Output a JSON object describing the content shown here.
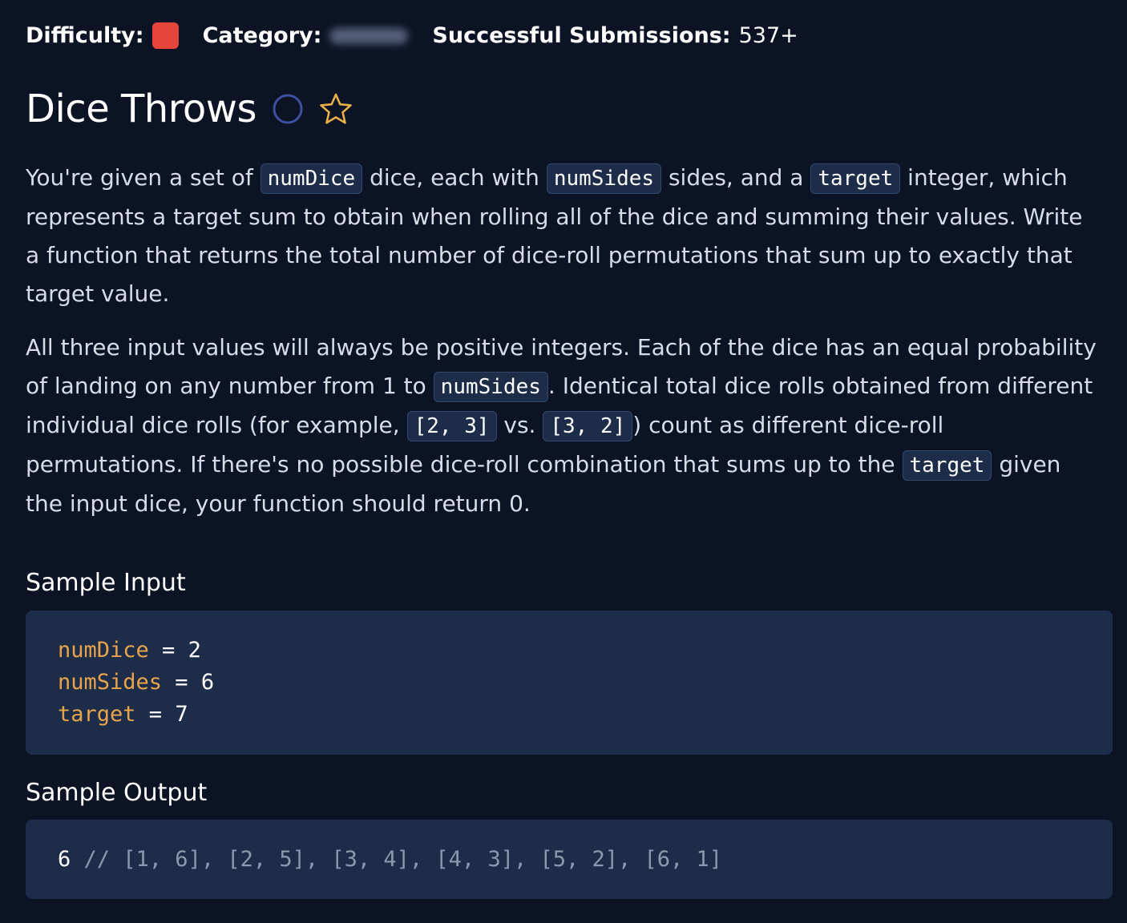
{
  "meta": {
    "difficulty_label": "Difficulty:",
    "difficulty_color": "#e5453a",
    "category_label": "Category:",
    "submissions_label": "Successful Submissions:",
    "submissions_value": "537+"
  },
  "title": "Dice Throws",
  "icons": {
    "status": "circle-icon",
    "favorite": "star-icon",
    "star_color": "#e8b04a",
    "circle_color": "#3d4f9e"
  },
  "description": {
    "p1": {
      "t1": "You're given a set of ",
      "c1": "numDice",
      "t2": " dice, each with ",
      "c2": "numSides",
      "t3": " sides, and a ",
      "c3": "target",
      "t4": " integer, which represents a target sum to obtain when rolling all of the dice and summing their values. Write a function that returns the total number of dice-roll permutations that sum up to exactly that target value."
    },
    "p2": {
      "t1": "All three input values will always be positive integers. Each of the dice has an equal probability of landing on any number from 1 to ",
      "c1": "numSides",
      "t2": ". Identical total dice rolls obtained from different individual dice rolls (for example, ",
      "c2": "[2, 3]",
      "t3": " vs. ",
      "c3": "[3, 2]",
      "t4": ") count as different dice-roll permutations. If there's no possible dice-roll combination that sums up to the ",
      "c4": "target",
      "t5": " given the input dice, your function should return 0."
    }
  },
  "sample_input": {
    "heading": "Sample Input",
    "lines": [
      {
        "var": "numDice",
        "op": " = ",
        "val": "2"
      },
      {
        "var": "numSides",
        "op": " = ",
        "val": "6"
      },
      {
        "var": "target",
        "op": " = ",
        "val": "7"
      }
    ]
  },
  "sample_output": {
    "heading": "Sample Output",
    "value": "6",
    "comment": " // [1, 6], [2, 5], [3, 4], [4, 3], [5, 2], [6, 1]"
  }
}
